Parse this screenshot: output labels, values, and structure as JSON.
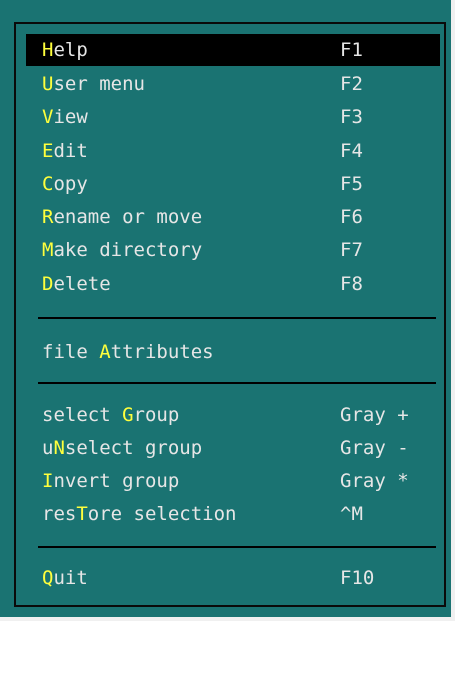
{
  "colors": {
    "panel_background": "#1a7372",
    "item_text": "#e6e6e6",
    "hotkey_letter": "#ffff3c",
    "selected_background": "#000000",
    "separator": "#000000"
  },
  "menu": {
    "items": [
      {
        "before": "",
        "hot": "H",
        "after": "elp",
        "key": "F1"
      },
      {
        "before": "",
        "hot": "U",
        "after": "ser menu",
        "key": "F2"
      },
      {
        "before": "",
        "hot": "V",
        "after": "iew",
        "key": "F3"
      },
      {
        "before": "",
        "hot": "E",
        "after": "dit",
        "key": "F4"
      },
      {
        "before": "",
        "hot": "C",
        "after": "opy",
        "key": "F5"
      },
      {
        "before": "",
        "hot": "R",
        "after": "ename or move",
        "key": "F6"
      },
      {
        "before": "",
        "hot": "M",
        "after": "ake directory",
        "key": "F7"
      },
      {
        "before": "",
        "hot": "D",
        "after": "elete",
        "key": "F8"
      },
      {
        "before": "file ",
        "hot": "A",
        "after": "ttributes",
        "key": ""
      },
      {
        "before": "select ",
        "hot": "G",
        "after": "roup",
        "key": "Gray +"
      },
      {
        "before": "u",
        "hot": "N",
        "after": "select group",
        "key": "Gray -"
      },
      {
        "before": "",
        "hot": "I",
        "after": "nvert group",
        "key": "Gray *"
      },
      {
        "before": "res",
        "hot": "T",
        "after": "ore selection",
        "key": "^M"
      },
      {
        "before": "",
        "hot": "Q",
        "after": "uit",
        "key": "F10"
      }
    ],
    "selected_index": 0
  }
}
